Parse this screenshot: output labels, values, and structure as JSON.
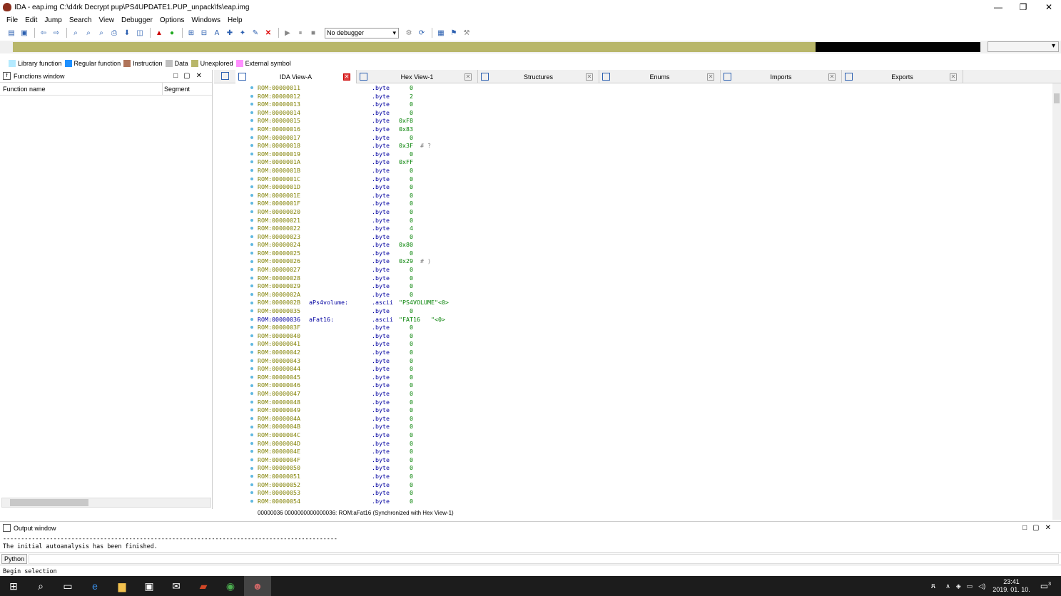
{
  "window": {
    "title": "IDA - eap.img C:\\d4rk Decrypt pup\\PS4UPDATE1.PUP_unpack\\fs\\eap.img",
    "min": "—",
    "max": "❐",
    "close": "✕"
  },
  "menu": [
    "File",
    "Edit",
    "Jump",
    "Search",
    "View",
    "Debugger",
    "Options",
    "Windows",
    "Help"
  ],
  "toolbar": {
    "debugger_select": "No debugger"
  },
  "legend": [
    {
      "label": "Library function",
      "color": "#b4eaff"
    },
    {
      "label": "Regular function",
      "color": "#1e90ff"
    },
    {
      "label": "Instruction",
      "color": "#b0745a"
    },
    {
      "label": "Data",
      "color": "#c0c0c0"
    },
    {
      "label": "Unexplored",
      "color": "#b8b66a"
    },
    {
      "label": "External symbol",
      "color": "#ff90ff"
    }
  ],
  "functions_window": {
    "title": "Functions window",
    "col_name": "Function name",
    "col_segment": "Segment"
  },
  "tabs": [
    {
      "label": "IDA View-A",
      "active": true
    },
    {
      "label": "Hex View-1",
      "active": false
    },
    {
      "label": "Structures",
      "active": false
    },
    {
      "label": "Enums",
      "active": false
    },
    {
      "label": "Imports",
      "active": false
    },
    {
      "label": "Exports",
      "active": false
    }
  ],
  "disasm": [
    {
      "a": "ROM:00000011",
      "l": "",
      "m": ".byte",
      "o": "   0",
      "c": ""
    },
    {
      "a": "ROM:00000012",
      "l": "",
      "m": ".byte",
      "o": "   2",
      "c": ""
    },
    {
      "a": "ROM:00000013",
      "l": "",
      "m": ".byte",
      "o": "   0",
      "c": ""
    },
    {
      "a": "ROM:00000014",
      "l": "",
      "m": ".byte",
      "o": "   0",
      "c": ""
    },
    {
      "a": "ROM:00000015",
      "l": "",
      "m": ".byte",
      "o": "0xF8",
      "c": ""
    },
    {
      "a": "ROM:00000016",
      "l": "",
      "m": ".byte",
      "o": "0x83",
      "c": ""
    },
    {
      "a": "ROM:00000017",
      "l": "",
      "m": ".byte",
      "o": "   0",
      "c": ""
    },
    {
      "a": "ROM:00000018",
      "l": "",
      "m": ".byte",
      "o": "0x3F",
      "c": "# ?"
    },
    {
      "a": "ROM:00000019",
      "l": "",
      "m": ".byte",
      "o": "   0",
      "c": ""
    },
    {
      "a": "ROM:0000001A",
      "l": "",
      "m": ".byte",
      "o": "0xFF",
      "c": ""
    },
    {
      "a": "ROM:0000001B",
      "l": "",
      "m": ".byte",
      "o": "   0",
      "c": ""
    },
    {
      "a": "ROM:0000001C",
      "l": "",
      "m": ".byte",
      "o": "   0",
      "c": ""
    },
    {
      "a": "ROM:0000001D",
      "l": "",
      "m": ".byte",
      "o": "   0",
      "c": ""
    },
    {
      "a": "ROM:0000001E",
      "l": "",
      "m": ".byte",
      "o": "   0",
      "c": ""
    },
    {
      "a": "ROM:0000001F",
      "l": "",
      "m": ".byte",
      "o": "   0",
      "c": ""
    },
    {
      "a": "ROM:00000020",
      "l": "",
      "m": ".byte",
      "o": "   0",
      "c": ""
    },
    {
      "a": "ROM:00000021",
      "l": "",
      "m": ".byte",
      "o": "   0",
      "c": ""
    },
    {
      "a": "ROM:00000022",
      "l": "",
      "m": ".byte",
      "o": "   4",
      "c": ""
    },
    {
      "a": "ROM:00000023",
      "l": "",
      "m": ".byte",
      "o": "   0",
      "c": ""
    },
    {
      "a": "ROM:00000024",
      "l": "",
      "m": ".byte",
      "o": "0x80",
      "c": ""
    },
    {
      "a": "ROM:00000025",
      "l": "",
      "m": ".byte",
      "o": "   0",
      "c": ""
    },
    {
      "a": "ROM:00000026",
      "l": "",
      "m": ".byte",
      "o": "0x29",
      "c": "# )"
    },
    {
      "a": "ROM:00000027",
      "l": "",
      "m": ".byte",
      "o": "   0",
      "c": ""
    },
    {
      "a": "ROM:00000028",
      "l": "",
      "m": ".byte",
      "o": "   0",
      "c": ""
    },
    {
      "a": "ROM:00000029",
      "l": "",
      "m": ".byte",
      "o": "   0",
      "c": ""
    },
    {
      "a": "ROM:0000002A",
      "l": "",
      "m": ".byte",
      "o": "   0",
      "c": ""
    },
    {
      "a": "ROM:0000002B",
      "l": "aPs4volume:",
      "m": ".ascii",
      "o": "\"PS4VOLUME\"<0>",
      "c": ""
    },
    {
      "a": "ROM:00000035",
      "l": "",
      "m": ".byte",
      "o": "   0",
      "c": ""
    },
    {
      "a": "ROM:00000036",
      "l": "aFat16:",
      "m": ".ascii",
      "o": "\"FAT16   \"<0>",
      "c": "",
      "cur": true
    },
    {
      "a": "ROM:0000003F",
      "l": "",
      "m": ".byte",
      "o": "   0",
      "c": ""
    },
    {
      "a": "ROM:00000040",
      "l": "",
      "m": ".byte",
      "o": "   0",
      "c": ""
    },
    {
      "a": "ROM:00000041",
      "l": "",
      "m": ".byte",
      "o": "   0",
      "c": ""
    },
    {
      "a": "ROM:00000042",
      "l": "",
      "m": ".byte",
      "o": "   0",
      "c": ""
    },
    {
      "a": "ROM:00000043",
      "l": "",
      "m": ".byte",
      "o": "   0",
      "c": ""
    },
    {
      "a": "ROM:00000044",
      "l": "",
      "m": ".byte",
      "o": "   0",
      "c": ""
    },
    {
      "a": "ROM:00000045",
      "l": "",
      "m": ".byte",
      "o": "   0",
      "c": ""
    },
    {
      "a": "ROM:00000046",
      "l": "",
      "m": ".byte",
      "o": "   0",
      "c": ""
    },
    {
      "a": "ROM:00000047",
      "l": "",
      "m": ".byte",
      "o": "   0",
      "c": ""
    },
    {
      "a": "ROM:00000048",
      "l": "",
      "m": ".byte",
      "o": "   0",
      "c": ""
    },
    {
      "a": "ROM:00000049",
      "l": "",
      "m": ".byte",
      "o": "   0",
      "c": ""
    },
    {
      "a": "ROM:0000004A",
      "l": "",
      "m": ".byte",
      "o": "   0",
      "c": ""
    },
    {
      "a": "ROM:0000004B",
      "l": "",
      "m": ".byte",
      "o": "   0",
      "c": ""
    },
    {
      "a": "ROM:0000004C",
      "l": "",
      "m": ".byte",
      "o": "   0",
      "c": ""
    },
    {
      "a": "ROM:0000004D",
      "l": "",
      "m": ".byte",
      "o": "   0",
      "c": ""
    },
    {
      "a": "ROM:0000004E",
      "l": "",
      "m": ".byte",
      "o": "   0",
      "c": ""
    },
    {
      "a": "ROM:0000004F",
      "l": "",
      "m": ".byte",
      "o": "   0",
      "c": ""
    },
    {
      "a": "ROM:00000050",
      "l": "",
      "m": ".byte",
      "o": "   0",
      "c": ""
    },
    {
      "a": "ROM:00000051",
      "l": "",
      "m": ".byte",
      "o": "   0",
      "c": ""
    },
    {
      "a": "ROM:00000052",
      "l": "",
      "m": ".byte",
      "o": "   0",
      "c": ""
    },
    {
      "a": "ROM:00000053",
      "l": "",
      "m": ".byte",
      "o": "   0",
      "c": ""
    },
    {
      "a": "ROM:00000054",
      "l": "",
      "m": ".byte",
      "o": "   0",
      "c": ""
    }
  ],
  "sync_status": "00000036 0000000000000036: ROM:aFat16 (Synchronized with Hex View-1)",
  "output_window": {
    "title": "Output window",
    "divider": "---------------------------------------------------------------------------------------------",
    "message": "The initial autoanalysis has been finished."
  },
  "python_button": "Python",
  "status_text": "Begin selection",
  "clock": {
    "time": "23:41",
    "date": "2019. 01. 10."
  },
  "notifications": "3"
}
